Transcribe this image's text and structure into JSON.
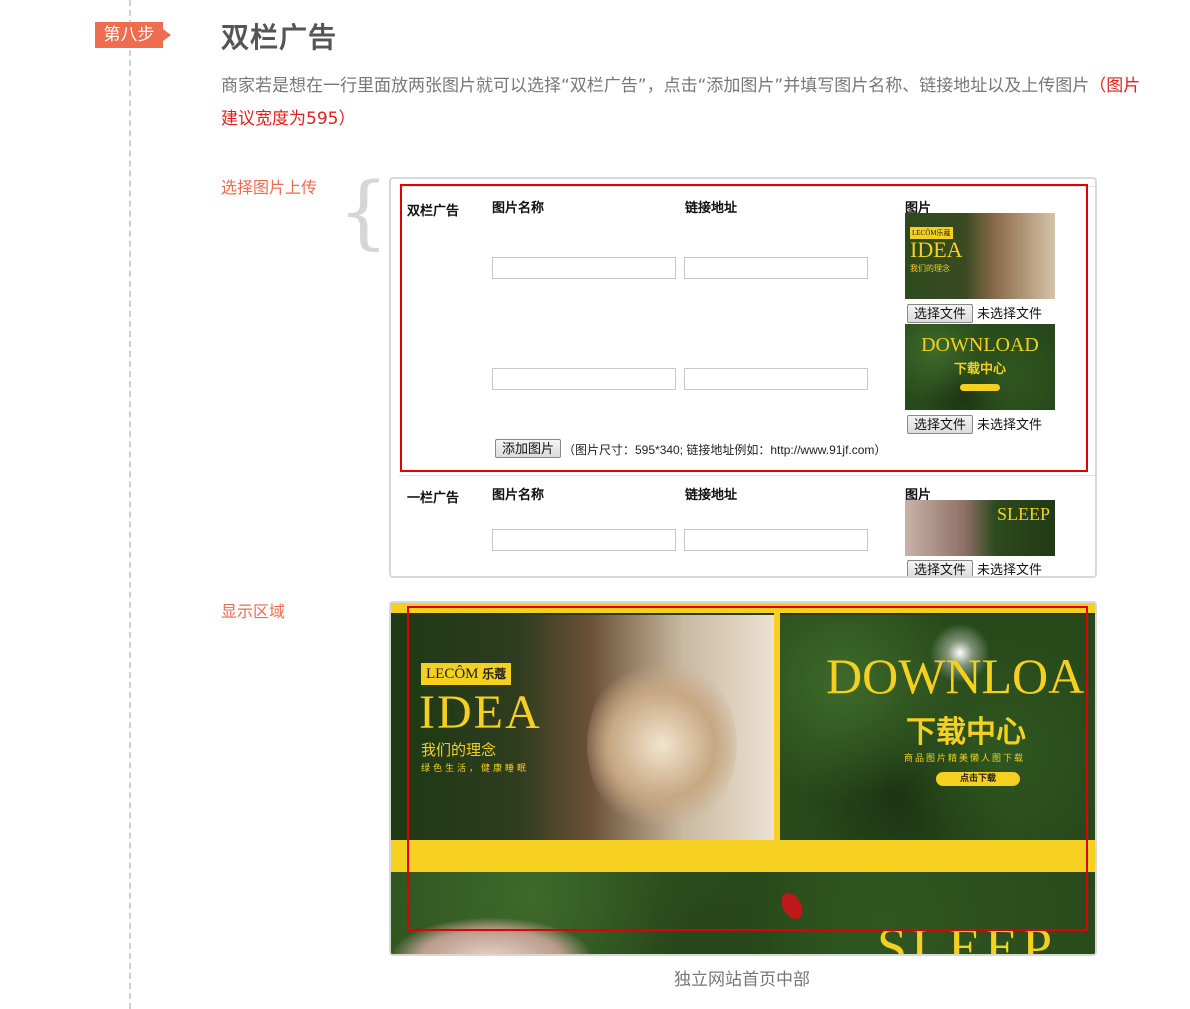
{
  "step": {
    "badge": "第八步",
    "title": "双栏广告"
  },
  "description": {
    "text": "商家若是想在一行里面放两张图片就可以选择“双栏广告”，点击“添加图片”并填写图片名称、链接地址以及上传图片",
    "highlight": "（图片建议宽度为595）"
  },
  "upload_section": {
    "label": "选择图片上传",
    "double_ad": {
      "row_label": "双栏广告",
      "col_name": "图片名称",
      "col_link": "链接地址",
      "col_image": "图片",
      "items": [
        {
          "name_value": "",
          "link_value": "",
          "thumb_icon": "idea-banner-thumbnail",
          "thumb_logo": "LECÔM乐蔻",
          "thumb_title": "IDEA",
          "thumb_sub": "我们的理念",
          "file_button": "选择文件",
          "file_status": "未选择文件"
        },
        {
          "name_value": "",
          "link_value": "",
          "thumb_icon": "download-banner-thumbnail",
          "thumb_title": "DOWNLOAD",
          "thumb_sub": "下载中心",
          "file_button": "选择文件",
          "file_status": "未选择文件"
        }
      ],
      "add_button": "添加图片",
      "size_note": "（图片尺寸：595*340; 链接地址例如：http://www.91jf.com）"
    },
    "single_ad": {
      "row_label": "一栏广告",
      "col_name": "图片名称",
      "col_link": "链接地址",
      "col_image": "图片",
      "item": {
        "name_value": "",
        "link_value": "",
        "thumb_icon": "sleep-banner-thumbnail",
        "thumb_title": "SLEEP",
        "file_button": "选择文件",
        "file_status": "未选择文件"
      }
    }
  },
  "display_section": {
    "label": "显示区域",
    "left_banner": {
      "logo": "LECÔM",
      "logo_tag": "乐蔻",
      "title": "IDEA",
      "subtitle": "我们的理念",
      "tagline": "绿色生活，健康睡眠"
    },
    "right_banner": {
      "title": "DOWNLOA",
      "subtitle": "下载中心",
      "tagline": "商品图片精美懒人图下载",
      "button": "点击下载"
    },
    "bottom_banner": {
      "title": "SLEEP"
    },
    "caption": "独立网站首页中部"
  },
  "colors": {
    "accent": "#ee6c4f",
    "highlight_red": "#e02020",
    "banner_yellow": "#f5d020",
    "forest_green": "#284a1b"
  }
}
